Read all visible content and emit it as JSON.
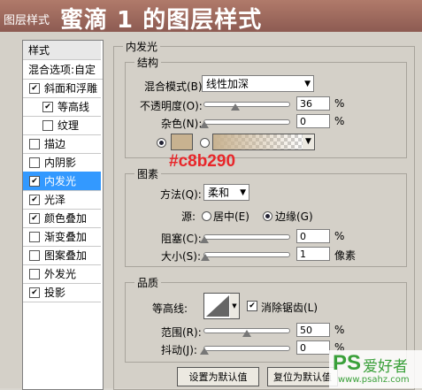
{
  "title": {
    "small": "图层样式",
    "big": "蜜滴 1 的图层样式"
  },
  "sidebar": {
    "header": "样式",
    "items": [
      {
        "label": "混合选项:自定",
        "checkbox": null,
        "indent": false,
        "selected": false
      },
      {
        "label": "斜面和浮雕",
        "checkbox": true,
        "indent": false,
        "selected": false
      },
      {
        "label": "等高线",
        "checkbox": true,
        "indent": true,
        "selected": false
      },
      {
        "label": "纹理",
        "checkbox": false,
        "indent": true,
        "selected": false
      },
      {
        "label": "描边",
        "checkbox": false,
        "indent": false,
        "selected": false
      },
      {
        "label": "内阴影",
        "checkbox": false,
        "indent": false,
        "selected": false
      },
      {
        "label": "内发光",
        "checkbox": true,
        "indent": false,
        "selected": true
      },
      {
        "label": "光泽",
        "checkbox": true,
        "indent": false,
        "selected": false
      },
      {
        "label": "颜色叠加",
        "checkbox": true,
        "indent": false,
        "selected": false
      },
      {
        "label": "渐变叠加",
        "checkbox": false,
        "indent": false,
        "selected": false
      },
      {
        "label": "图案叠加",
        "checkbox": false,
        "indent": false,
        "selected": false
      },
      {
        "label": "外发光",
        "checkbox": false,
        "indent": false,
        "selected": false
      },
      {
        "label": "投影",
        "checkbox": true,
        "indent": false,
        "selected": false
      }
    ]
  },
  "panel": {
    "title": "内发光",
    "structure": {
      "title": "结构",
      "blend_label": "混合模式(B):",
      "blend_value": "线性加深",
      "opacity_label": "不透明度(O):",
      "opacity_value": "36",
      "opacity_unit": "%",
      "opacity_level": 0.36,
      "noise_label": "杂色(N):",
      "noise_value": "0",
      "noise_unit": "%",
      "noise_level": 0,
      "glow_color": "#c8b290",
      "color_note": "#c8b290"
    },
    "elements": {
      "title": "图素",
      "method_label": "方法(Q):",
      "method_value": "柔和",
      "source_label": "源:",
      "source_center": "居中(E)",
      "source_edge": "边缘(G)",
      "source_selected": "edge",
      "choke_label": "阻塞(C):",
      "choke_value": "0",
      "choke_unit": "%",
      "choke_level": 0,
      "size_label": "大小(S):",
      "size_value": "1",
      "size_unit": "像素",
      "size_level": 0.01
    },
    "quality": {
      "title": "品质",
      "contour_label": "等高线:",
      "antialias_label": "消除锯齿(L)",
      "antialias_checked": true,
      "range_label": "范围(R):",
      "range_value": "50",
      "range_unit": "%",
      "range_level": 0.5,
      "jitter_label": "抖动(J):",
      "jitter_value": "0",
      "jitter_unit": "%",
      "jitter_level": 0
    },
    "buttons": {
      "default": "设置为默认值",
      "reset": "复位为默认值"
    }
  },
  "watermark": {
    "logo": "PS",
    "text": "爱好者",
    "url": "www.psahz.com"
  }
}
